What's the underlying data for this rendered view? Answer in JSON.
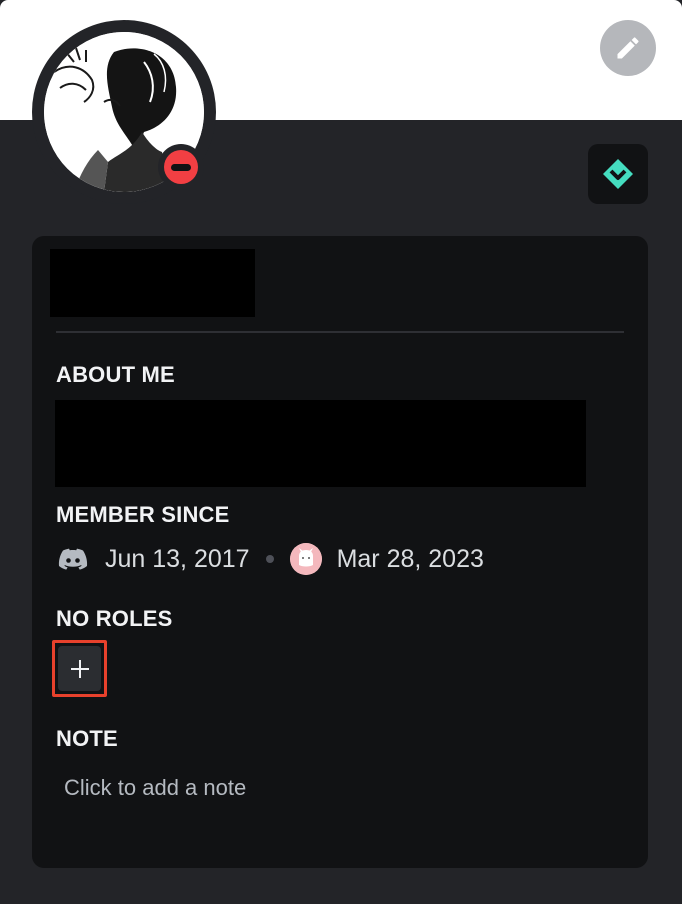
{
  "profile": {
    "status": "do-not-disturb",
    "icons": {
      "edit": "pencil-icon",
      "badge": "hypesquad-balance-icon",
      "discord": "discord-logo-icon",
      "server": "server-icon",
      "add": "plus-icon"
    },
    "colors": {
      "banner": "#ffffff",
      "background": "#232428",
      "card": "#111214",
      "status_dnd": "#f23f43",
      "badge": "#45ddc0",
      "highlight": "#e8412c"
    }
  },
  "about": {
    "title": "ABOUT ME"
  },
  "member_since": {
    "title": "MEMBER SINCE",
    "discord_date": "Jun 13, 2017",
    "server_date": "Mar 28, 2023"
  },
  "roles": {
    "title": "NO ROLES",
    "add_symbol": "+"
  },
  "note": {
    "title": "NOTE",
    "placeholder": "Click to add a note"
  }
}
